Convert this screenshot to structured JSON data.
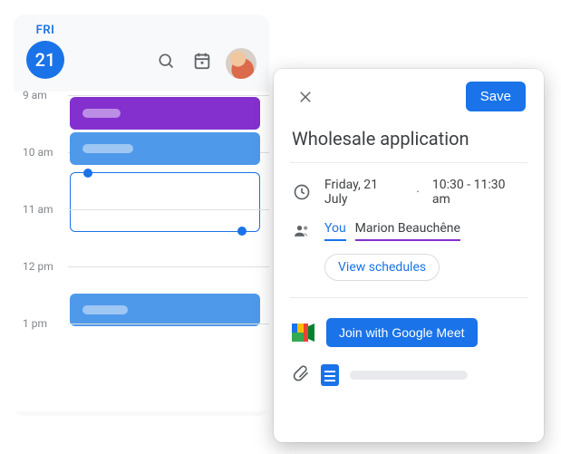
{
  "calendar": {
    "weekday": "FRI",
    "date": "21",
    "hours": [
      "9 am",
      "10 am",
      "11 am",
      "12 pm",
      "1 pm"
    ]
  },
  "event": {
    "save_label": "Save",
    "title": "Wholesale application",
    "date_text": "Friday, 21 July",
    "dot": "·",
    "time_text": "10:30 - 11:30 am",
    "guest_you": "You",
    "guest_marion": "Marion Beauchêne",
    "view_schedules": "View schedules",
    "meet_label": "Join with Google Meet"
  }
}
